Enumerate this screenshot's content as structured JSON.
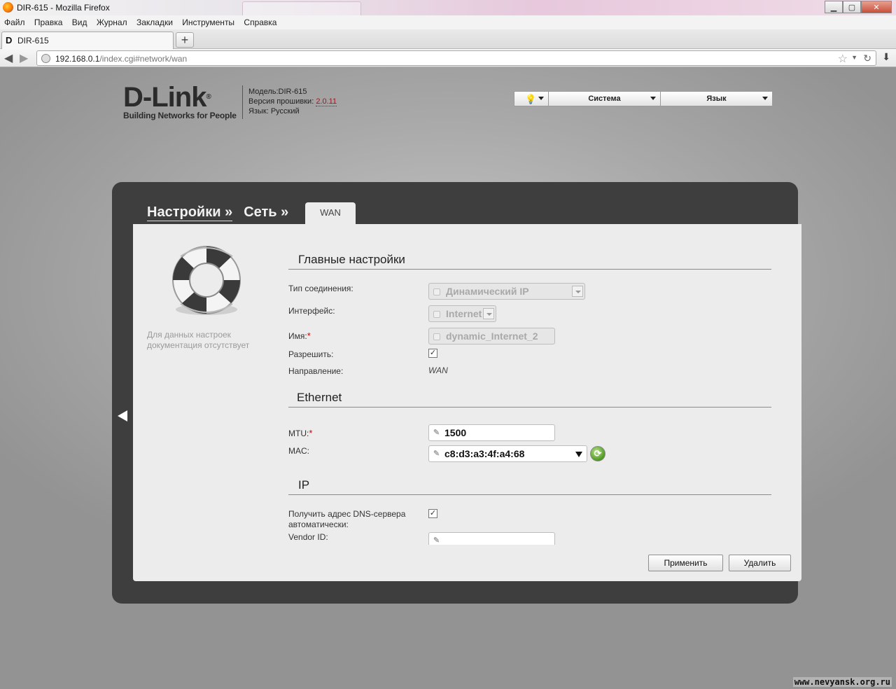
{
  "window": {
    "title": "DIR-615 - Mozilla Firefox",
    "controls": {
      "minimize": "▁",
      "maximize": "▢",
      "close": "✕"
    }
  },
  "menubar": [
    "Файл",
    "Правка",
    "Вид",
    "Журнал",
    "Закладки",
    "Инструменты",
    "Справка"
  ],
  "tab": {
    "title": "DIR-615",
    "favicon": "D",
    "newtab": "+"
  },
  "nav": {
    "url_host": "192.168.0.1",
    "url_path": "/index.cgi#network/wan"
  },
  "header": {
    "brand": "D-Link",
    "brand_reg": "®",
    "tagline": "Building Networks for People",
    "model": "Модель:DIR-615",
    "firmware_label": "Версия прошивки: ",
    "firmware_value": "2.0.11",
    "language": "Язык: Русский"
  },
  "topmenu": {
    "system": "Система",
    "language": "Язык"
  },
  "breadcrumbs": {
    "settings": "Настройки »",
    "network": "Сеть »",
    "current_tab": "WAN"
  },
  "help": {
    "line1": "Для данных настроек",
    "line2": "документация отсутствует"
  },
  "main": {
    "title": "Главные настройки",
    "connection_type_label": "Тип соединения:",
    "connection_type_value": "Динамический IP",
    "interface_label": "Интерфейс:",
    "interface_value": "Internet",
    "name_label": "Имя:",
    "name_value": "dynamic_Internet_2",
    "enable_label": "Разрешить:",
    "direction_label": "Направление:",
    "direction_value": "WAN"
  },
  "ethernet": {
    "title": "Ethernet",
    "mtu_label": "MTU:",
    "mtu_value": "1500",
    "mac_label": "MAC:",
    "mac_value": "c8:d3:a3:4f:a4:68"
  },
  "ip": {
    "title": "IP",
    "dns_label_1": "Получить адрес DNS-сервера",
    "dns_label_2": "автоматически:",
    "vendor_label": "Vendor ID:",
    "vendor_value": ""
  },
  "required_mark": "*",
  "checkmark": "✓",
  "buttons": {
    "apply": "Применить",
    "delete": "Удалить"
  },
  "watermark": "www.nevyansk.org.ru"
}
